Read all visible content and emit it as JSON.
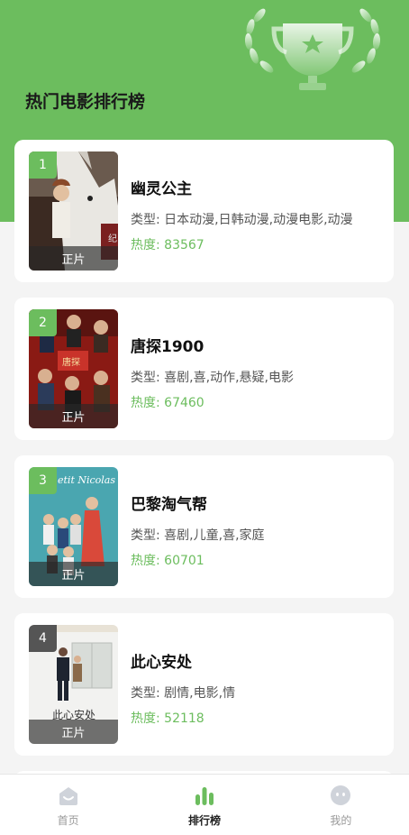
{
  "header": {
    "title": "热门电影排行榜",
    "trophy_icon": "trophy-icon",
    "accent_color": "#6cbd5e"
  },
  "movies": [
    {
      "rank": "1",
      "title": "幽灵公主",
      "genre": "类型: 日本动漫,日韩动漫,动漫电影,动漫",
      "heat": "热度: 83567",
      "tag": "正片",
      "poster_overlay": ""
    },
    {
      "rank": "2",
      "title": "唐探1900",
      "genre": "类型: 喜剧,喜,动作,悬疑,电影",
      "heat": "热度: 67460",
      "tag": "正片",
      "poster_overlay": ""
    },
    {
      "rank": "3",
      "title": "巴黎淘气帮",
      "genre": "类型: 喜剧,儿童,喜,家庭",
      "heat": "热度: 60701",
      "tag": "正片",
      "poster_overlay": "etit Nicolas"
    },
    {
      "rank": "4",
      "title": "此心安处",
      "genre": "类型: 剧情,电影,情",
      "heat": "热度: 52118",
      "tag": "正片",
      "poster_overlay": "此心安处"
    }
  ],
  "tabbar": {
    "items": [
      {
        "label": "首页",
        "icon": "home-icon"
      },
      {
        "label": "排行榜",
        "icon": "ranking-icon",
        "active": true
      },
      {
        "label": "我的",
        "icon": "profile-icon"
      }
    ]
  }
}
